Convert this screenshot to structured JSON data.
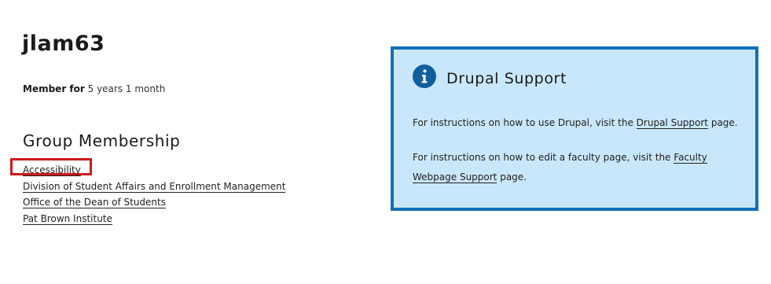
{
  "profile": {
    "username": "jlam63",
    "member_for_label": "Member for",
    "member_for_value": "5 years 1 month"
  },
  "groups": {
    "heading": "Group Membership",
    "items": [
      {
        "label": "Accessibility"
      },
      {
        "label": "Division of Student Affairs and Enrollment Management"
      },
      {
        "label": "Office of the Dean of Students"
      },
      {
        "label": "Pat Brown Institute"
      }
    ]
  },
  "support": {
    "icon": "info-icon",
    "title": "Drupal Support",
    "p1_before": "For instructions on how to use Drupal, visit the ",
    "p1_link": "Drupal Support",
    "p1_after": " page.",
    "p2_before": "For instructions on how to edit a faculty page, visit the ",
    "p2_link": "Faculty Webpage Support",
    "p2_after": " page."
  },
  "colors": {
    "highlight": "#d0191c",
    "support_bg": "#c9e7fb",
    "support_border": "#1070b8",
    "icon_bg": "#0f5f9e"
  }
}
